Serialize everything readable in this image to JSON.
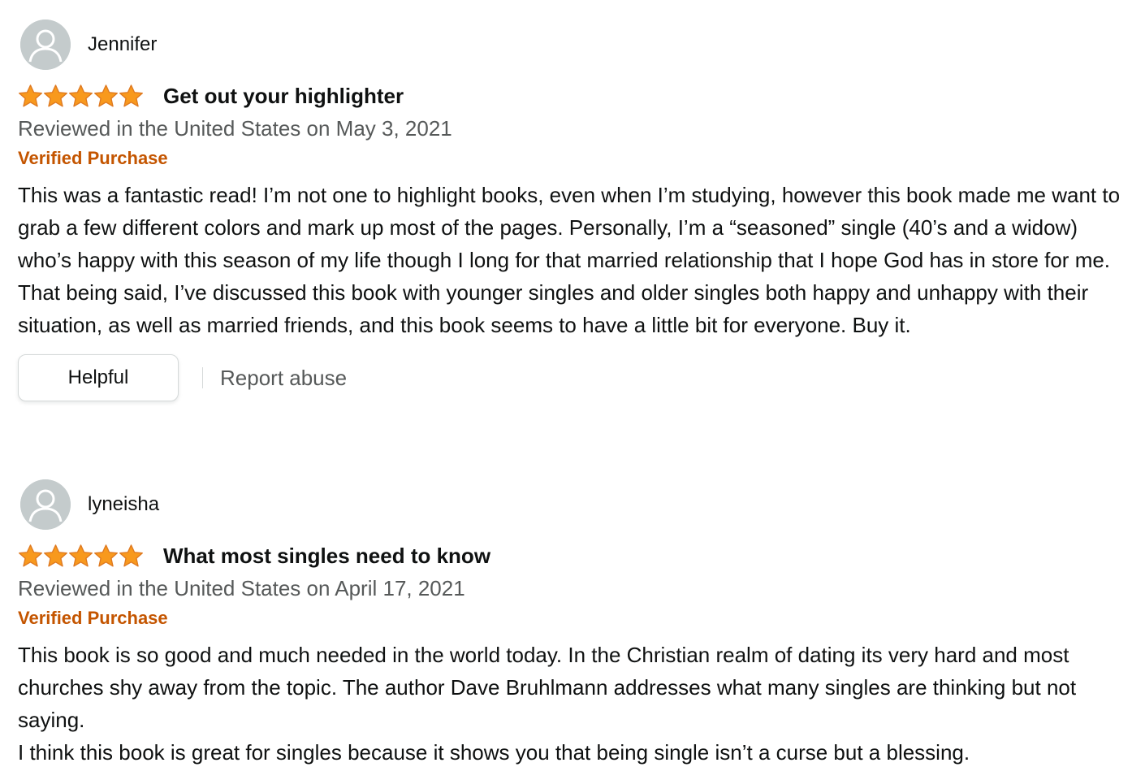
{
  "colors": {
    "star": "#f8991d",
    "star_stroke": "#de7921",
    "verified": "#c45500",
    "secondary_text": "#565959",
    "avatar_bg": "#c4cbcc"
  },
  "icons": {
    "avatar": "default-profile-icon",
    "star": "star-filled-icon"
  },
  "reviews": [
    {
      "profile_name": "Jennifer",
      "rating": 5,
      "title": "Get out your highlighter",
      "date_line": "Reviewed in the United States on May 3, 2021",
      "verified": "Verified Purchase",
      "body": [
        "This was a fantastic read! I’m not one to highlight books, even when I’m studying, however this book made me want to grab a few different colors and mark up most of the pages. Personally, I’m a “seasoned” single (40’s and a widow) who’s happy with this season of my life though I long for that married relationship that I hope God has in store for me. That being said, I’ve discussed this book with younger singles and older singles both happy and unhappy with their situation, as well as married friends, and this book seems to have a little bit for everyone. Buy it."
      ],
      "helpful_label": "Helpful",
      "report_label": "Report abuse"
    },
    {
      "profile_name": "lyneisha",
      "rating": 5,
      "title": "What most singles need to know",
      "date_line": "Reviewed in the United States on April 17, 2021",
      "verified": "Verified Purchase",
      "body": [
        "This book is so good and much needed in the world today. In the Christian realm of dating its very hard and most churches shy away from the topic. The author Dave Bruhlmann addresses what many singles are thinking but not saying.",
        "I think this book is great for singles because it shows you that being single isn’t a curse but a blessing."
      ]
    }
  ]
}
